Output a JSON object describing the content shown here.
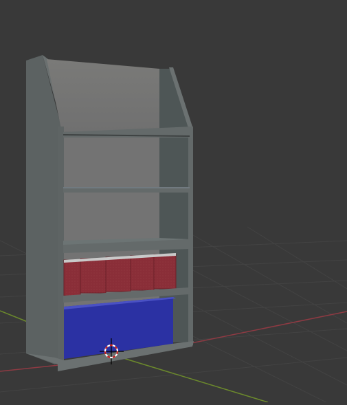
{
  "viewport": {
    "background": "#393939",
    "grid_color": "#414141",
    "x_axis_color": "#8f3a43",
    "y_axis_color": "#6c8a2c"
  },
  "scene": {
    "shelf_color": "#5f6464",
    "back_panel_color": "#757575",
    "books_red_color": "#8a2e38",
    "box_blue_color": "#2b31a3",
    "book_count": 6
  },
  "icons": {
    "cursor": "3d-cursor-icon"
  }
}
